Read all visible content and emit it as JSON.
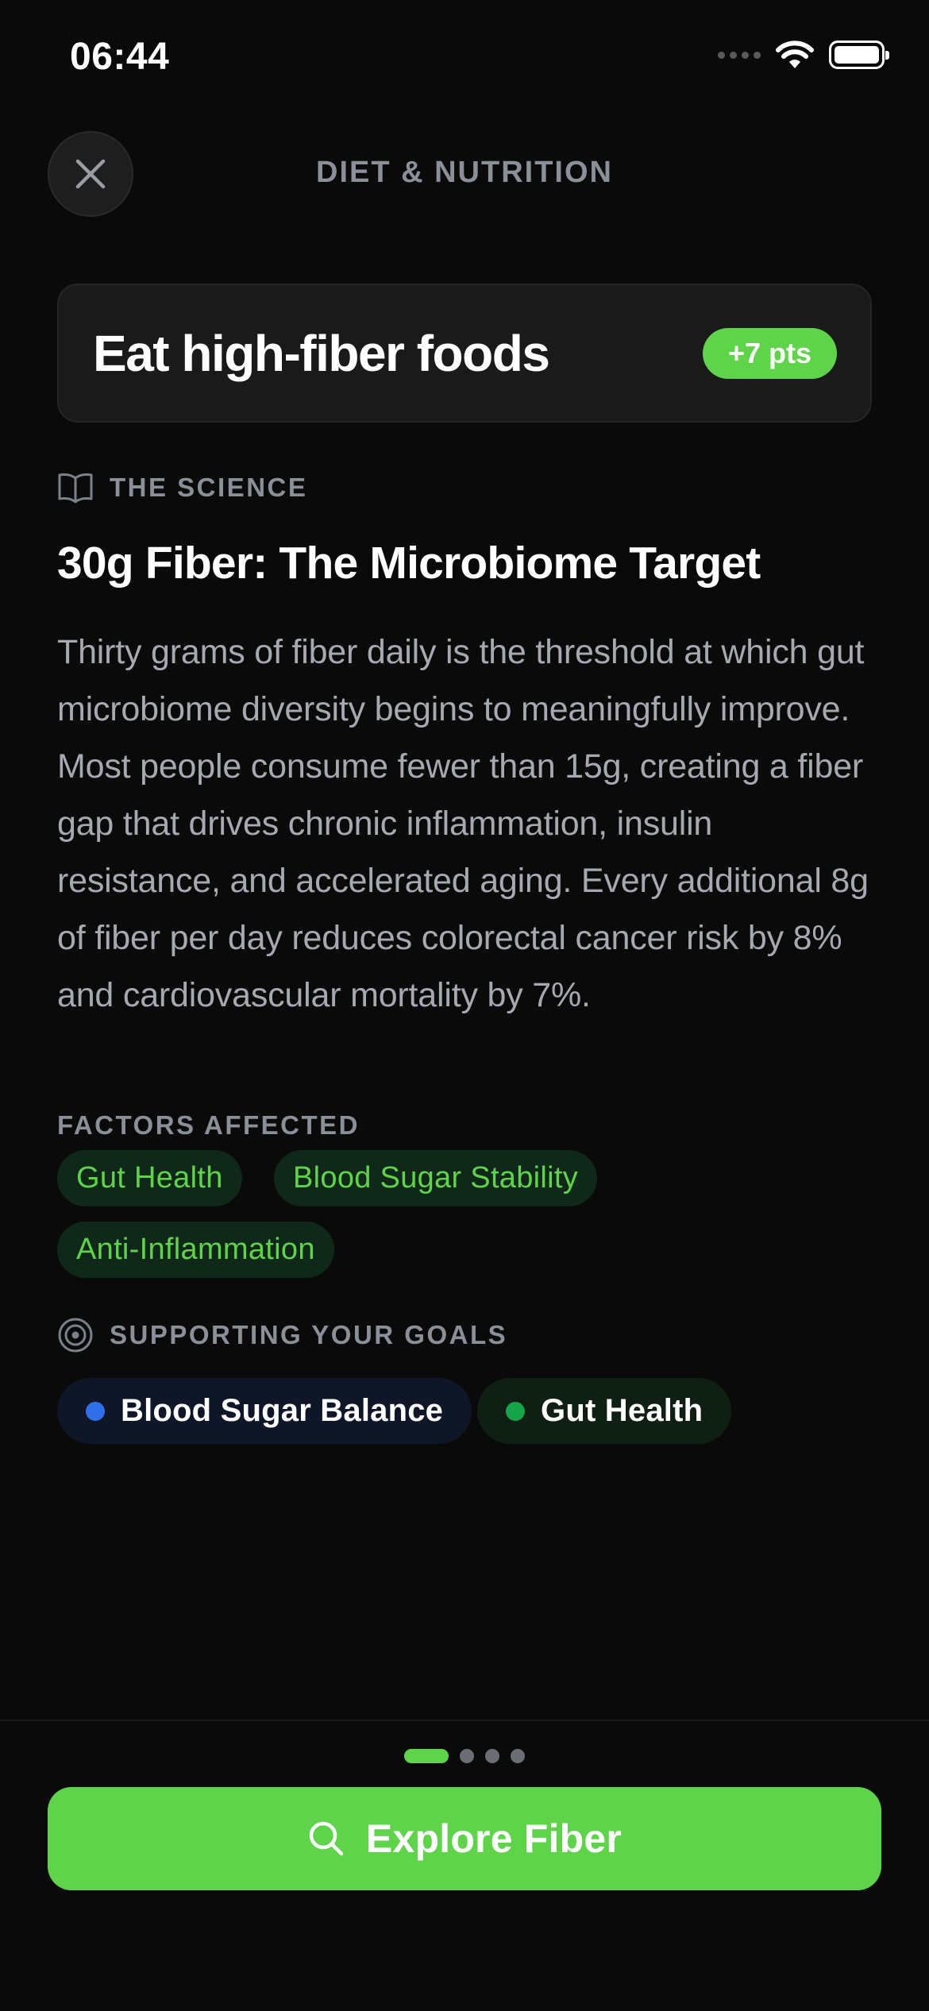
{
  "status_bar": {
    "time": "06:44",
    "icons": [
      "signal-dots-icon",
      "wifi-icon",
      "battery-icon"
    ]
  },
  "header": {
    "title": "DIET & NUTRITION",
    "close_icon": "close-icon"
  },
  "task": {
    "title": "Eat high-fiber foods",
    "points": "+7 pts"
  },
  "science": {
    "section_label": "THE SCIENCE",
    "section_icon": "book-icon",
    "heading": "30g Fiber: The Microbiome Target",
    "body": "Thirty grams of fiber daily is the threshold at which gut microbiome diversity begins to meaningfully improve. Most people consume fewer than 15g, creating a fiber gap that drives chronic inflammation, insulin resistance, and accelerated aging. Every additional 8g of fiber per day reduces colorectal cancer risk by 8% and cardiovascular mortality by 7%."
  },
  "factors": {
    "label": "FACTORS AFFECTED",
    "items": [
      "Gut Health",
      "Blood Sugar Stability",
      "Anti-Inflammation"
    ]
  },
  "goals": {
    "label": "SUPPORTING YOUR GOALS",
    "section_icon": "target-icon",
    "items": [
      {
        "label": "Blood Sugar Balance",
        "dot_color": "#2f6fe8",
        "chip_color": "#0f1628"
      },
      {
        "label": "Gut Health",
        "dot_color": "#16a34a",
        "chip_color": "#0f1f14"
      }
    ]
  },
  "pager": {
    "total": 4,
    "current": 1
  },
  "cta": {
    "label": "Explore Fiber",
    "icon": "search-icon"
  },
  "colors": {
    "accent": "#5fd44a",
    "background": "#0a0a0a",
    "muted_text": "#8b8f98"
  }
}
